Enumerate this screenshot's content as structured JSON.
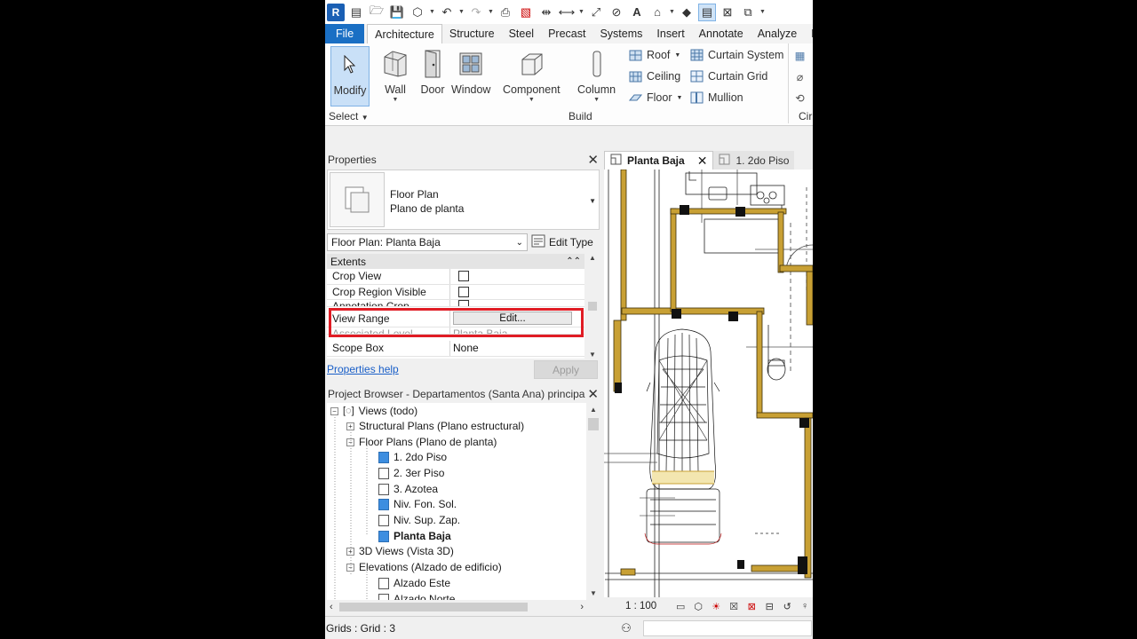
{
  "app": {
    "logo_letter": "R"
  },
  "ribbon_tabs": [
    "File",
    "Architecture",
    "Structure",
    "Steel",
    "Precast",
    "Systems",
    "Insert",
    "Annotate",
    "Analyze",
    "M"
  ],
  "ribbon": {
    "modify": "Modify",
    "select": "Select",
    "wall": "Wall",
    "door": "Door",
    "window": "Window",
    "component": "Component",
    "column": "Column",
    "roof": "Roof",
    "ceiling": "Ceiling",
    "floor": "Floor",
    "curtain_system": "Curtain System",
    "curtain_grid": "Curtain Grid",
    "mullion": "Mullion",
    "build_panel": "Build",
    "circ_panel": "Cir"
  },
  "properties": {
    "title": "Properties",
    "type_line1": "Floor Plan",
    "type_line2": "Plano de planta",
    "instance_selector": "Floor Plan: Planta Baja",
    "edit_type": "Edit Type",
    "group": "Extents",
    "rows": [
      {
        "name": "Crop View",
        "value": ""
      },
      {
        "name": "Crop Region Visible",
        "value": ""
      },
      {
        "name": "Annotation Crop",
        "value": ""
      },
      {
        "name": "View Range",
        "value": "Edit..."
      },
      {
        "name": "Associated Level",
        "value": "Planta Baja"
      },
      {
        "name": "Scope Box",
        "value": "None"
      }
    ],
    "help": "Properties help",
    "apply": "Apply"
  },
  "project_browser": {
    "title": "Project Browser - Departamentos (Santa Ana) principa...",
    "items": [
      {
        "label": "Views (todo)",
        "exp": "⊟"
      },
      {
        "label": "Structural Plans (Plano estructural)",
        "exp": "⊞"
      },
      {
        "label": "Floor Plans (Plano de planta)",
        "exp": "⊟"
      },
      {
        "label": "1. 2do Piso"
      },
      {
        "label": "2. 3er Piso"
      },
      {
        "label": "3. Azotea"
      },
      {
        "label": "Niv. Fon. Sol."
      },
      {
        "label": "Niv. Sup. Zap."
      },
      {
        "label": "Planta Baja"
      },
      {
        "label": "3D Views (Vista 3D)",
        "exp": "⊞"
      },
      {
        "label": "Elevations (Alzado de edificio)",
        "exp": "⊟"
      },
      {
        "label": "Alzado Este"
      },
      {
        "label": "Alzado Norte"
      }
    ]
  },
  "view_tabs": {
    "active": "Planta Baja",
    "inactive": "1. 2do Piso"
  },
  "view_control": {
    "scale": "1 : 100"
  },
  "status": {
    "text": "Grids : Grid : 3"
  },
  "colors": {
    "accent": "#1a6fc4",
    "highlight": "#e01c24",
    "wall": "#c8a034"
  }
}
